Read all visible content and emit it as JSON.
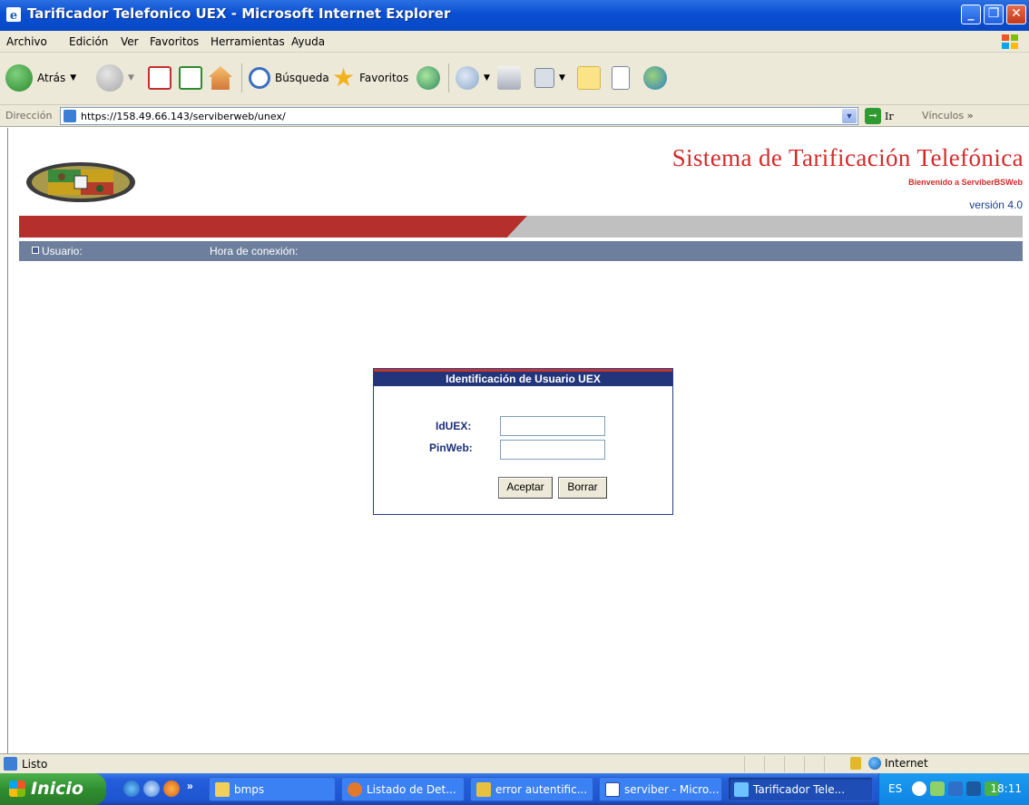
{
  "window": {
    "title": "Tarificador Telefonico UEX - Microsoft Internet Explorer"
  },
  "menu": {
    "items": [
      "Archivo",
      "Edición",
      "Ver",
      "Favoritos",
      "Herramientas",
      "Ayuda"
    ]
  },
  "toolbar": {
    "back": "Atrás",
    "search": "Búsqueda",
    "favorites": "Favoritos"
  },
  "address": {
    "label": "Dirección",
    "url": "https://158.49.66.143/serviberweb/unex/",
    "go": "Ir",
    "links": "Vínculos"
  },
  "page": {
    "title": "Sistema de Tarificación Telefónica",
    "welcome": "Bienvenido a ServiberBSWeb",
    "version": "versión 4.0",
    "user_label": "Usuario:",
    "connection_label": "Hora de conexión:"
  },
  "login": {
    "heading": "Identificación de Usuario UEX",
    "id_label": "IdUEX:",
    "pin_label": "PinWeb:",
    "id_value": "",
    "pin_value": "",
    "accept": "Aceptar",
    "clear": "Borrar"
  },
  "status": {
    "text": "Listo",
    "zone": "Internet"
  },
  "taskbar": {
    "start": "Inicio",
    "tasks": [
      "bmps",
      "Listado de Det...",
      "error autentific...",
      "serviber - Micro...",
      "Tarificador Tele..."
    ],
    "lang": "ES",
    "clock": "18:11"
  },
  "colors": {
    "brand_red": "#b5302c",
    "title_red": "#d42a2a",
    "navy": "#22357a",
    "info_bar": "#6d7f9d"
  }
}
